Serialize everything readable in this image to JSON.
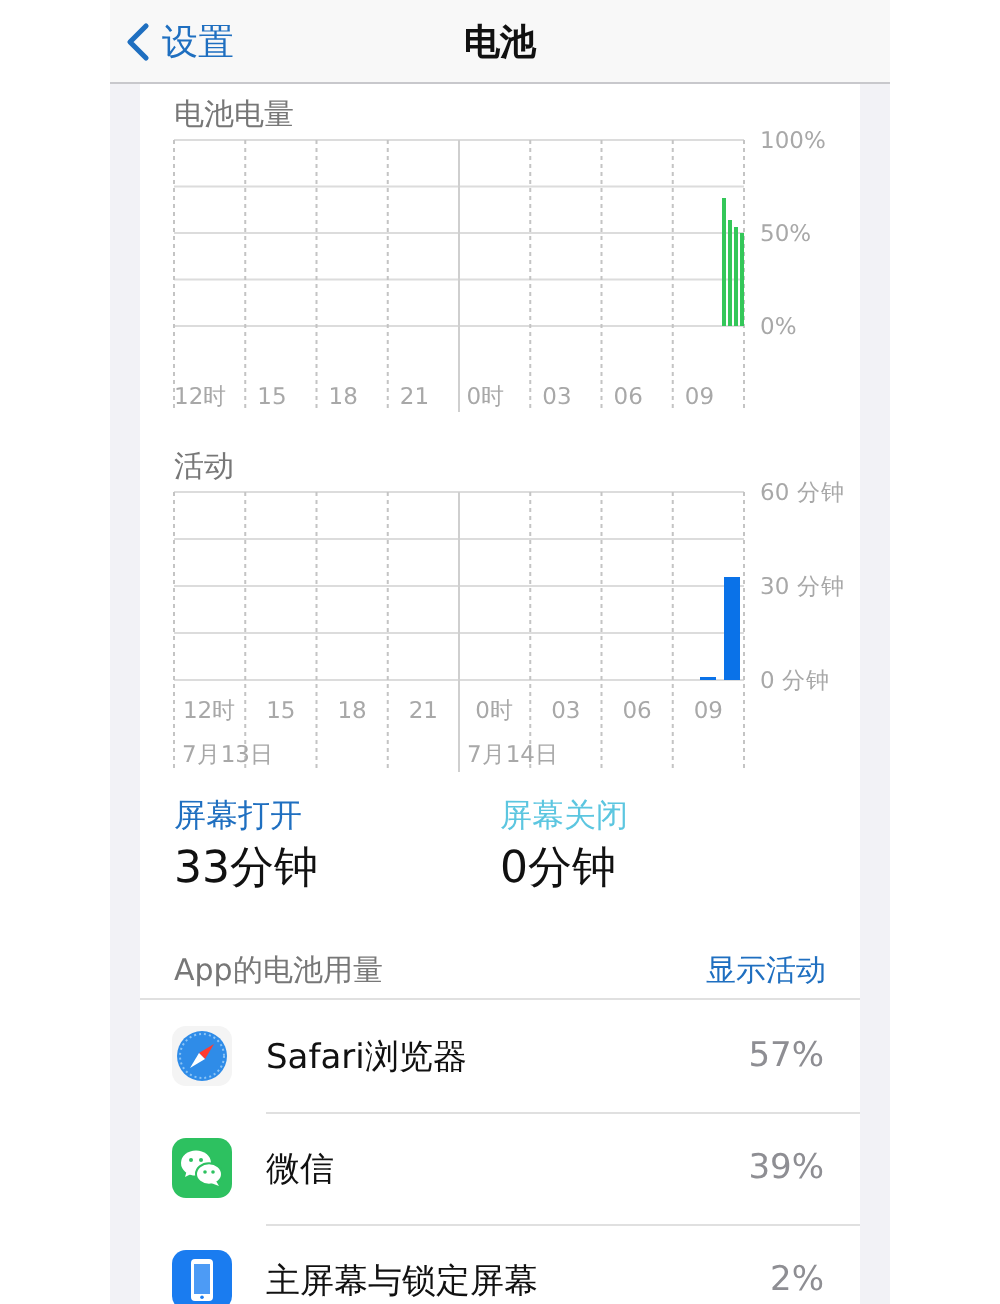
{
  "nav": {
    "back": "设置",
    "title": "电池"
  },
  "battery_level": {
    "title": "电池电量",
    "chart_data": {
      "type": "bar",
      "grid": true,
      "ylim": [
        0,
        100
      ],
      "categories": [
        null,
        null,
        null,
        null,
        "12时",
        null,
        null,
        null,
        null,
        null,
        null,
        null,
        null,
        null,
        null,
        null,
        "15",
        null,
        null,
        null,
        null,
        null,
        null,
        null,
        null,
        null,
        null,
        null,
        "18",
        null,
        null,
        null,
        null,
        null,
        null,
        null,
        null,
        null,
        null,
        null,
        "21",
        null,
        null,
        null,
        null,
        null,
        null,
        null,
        null,
        null,
        null,
        null,
        "0时",
        null,
        null,
        null,
        null,
        null,
        null,
        null,
        null,
        null,
        null,
        null,
        "03",
        null,
        null,
        null,
        null,
        null,
        null,
        null,
        null,
        null,
        null,
        null,
        "06",
        null,
        null,
        null,
        null,
        null,
        null,
        null,
        null,
        null,
        null,
        null,
        "09",
        null,
        null,
        null,
        null,
        null,
        null,
        null
      ],
      "yticks": [
        {
          "value": 100,
          "label": "100%"
        },
        {
          "value": 50,
          "label": "50%"
        },
        {
          "value": 0,
          "label": "0%"
        }
      ],
      "series": [
        {
          "color": "#34c759",
          "values": [
            null,
            null,
            null,
            null,
            null,
            null,
            null,
            null,
            null,
            null,
            null,
            null,
            null,
            null,
            null,
            null,
            null,
            null,
            null,
            null,
            null,
            null,
            null,
            null,
            null,
            null,
            null,
            null,
            null,
            null,
            null,
            null,
            null,
            null,
            null,
            null,
            null,
            null,
            null,
            null,
            null,
            null,
            null,
            null,
            null,
            null,
            null,
            null,
            null,
            null,
            null,
            null,
            null,
            null,
            null,
            null,
            null,
            null,
            null,
            null,
            null,
            null,
            null,
            null,
            null,
            null,
            null,
            null,
            null,
            null,
            null,
            null,
            null,
            null,
            null,
            null,
            null,
            null,
            null,
            null,
            null,
            null,
            null,
            null,
            null,
            null,
            null,
            null,
            null,
            null,
            null,
            null,
            69,
            57,
            53,
            50
          ]
        }
      ]
    }
  },
  "activity": {
    "title": "活动",
    "dates": [
      "7月13日",
      "7月14日"
    ],
    "chart_data": {
      "type": "bar",
      "grid": true,
      "ylim": [
        0,
        60
      ],
      "categories": [
        null,
        "12时",
        null,
        null,
        "15",
        null,
        null,
        "18",
        null,
        null,
        "21",
        null,
        null,
        "0时",
        null,
        null,
        "03",
        null,
        null,
        "06",
        null,
        null,
        "09",
        null
      ],
      "yticks": [
        {
          "value": 60,
          "label": "60 分钟"
        },
        {
          "value": 30,
          "label": "30 分钟"
        },
        {
          "value": 0,
          "label": "0 分钟"
        }
      ],
      "series": [
        {
          "color": "#0a72e8",
          "values": [
            null,
            null,
            null,
            null,
            null,
            null,
            null,
            null,
            null,
            null,
            null,
            null,
            null,
            null,
            null,
            null,
            null,
            null,
            null,
            null,
            null,
            null,
            1,
            33
          ]
        }
      ]
    }
  },
  "screen_time": [
    {
      "label": "屏幕打开",
      "value": "33分钟",
      "color": "#1f6fc0"
    },
    {
      "label": "屏幕关闭",
      "value": "0分钟",
      "color": "#5cc6e0"
    }
  ],
  "app_usage": {
    "title": "App的电池用量",
    "action": "显示活动",
    "apps": [
      {
        "name": "Safari浏览器",
        "percent": "57%"
      },
      {
        "name": "微信",
        "percent": "39%"
      },
      {
        "name": "主屏幕与锁定屏幕",
        "percent": "2%"
      }
    ]
  }
}
